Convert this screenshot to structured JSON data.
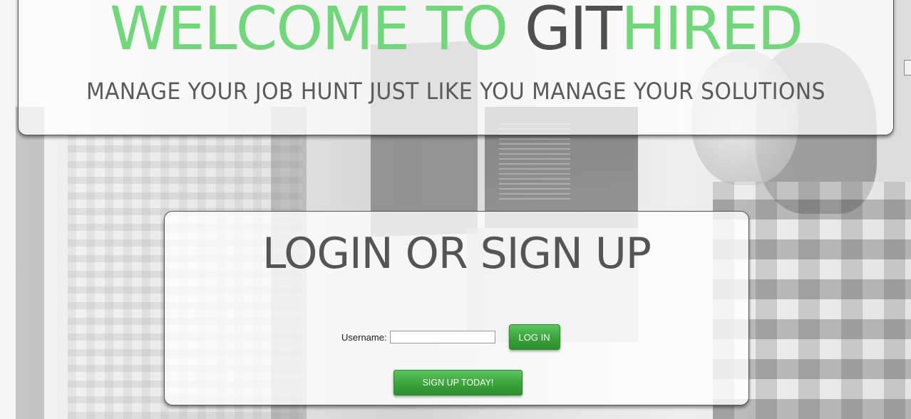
{
  "header": {
    "welcome_prefix": "WELCOME TO ",
    "brand_git": "GIT",
    "brand_hired": "HIRED",
    "tagline": "MANAGE YOUR JOB HUNT JUST LIKE YOU MANAGE YOUR SOLUTIONS"
  },
  "login": {
    "heading": "LOGIN OR SIGN UP",
    "username_label": "Username:",
    "username_value": "",
    "login_label": "LOG IN",
    "signup_label": "SIGN UP TODAY!"
  },
  "colors": {
    "accent_green": "#72d67b",
    "brand_gray": "#505050",
    "button_green": "#3aa33a"
  }
}
